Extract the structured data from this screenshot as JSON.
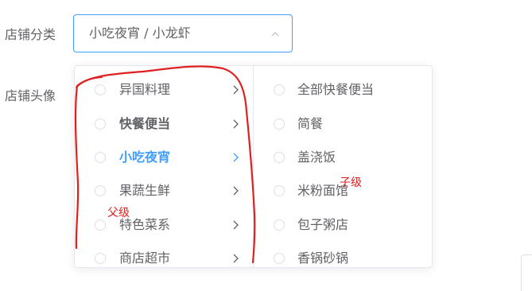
{
  "form": {
    "category_label": "店铺分类",
    "avatar_label": "店铺头像"
  },
  "select": {
    "value": "小吃夜宵 / 小龙虾",
    "arrow_icon": "chevron-up-icon",
    "border_color": "#409eff"
  },
  "cascader": {
    "parent_items": [
      {
        "label": "异国料理",
        "state": "normal"
      },
      {
        "label": "快餐便当",
        "state": "bold"
      },
      {
        "label": "小吃夜宵",
        "state": "active"
      },
      {
        "label": "果蔬生鲜",
        "state": "normal"
      },
      {
        "label": "特色菜系",
        "state": "normal"
      },
      {
        "label": "商店超市",
        "state": "normal"
      }
    ],
    "child_items": [
      {
        "label": "全部快餐便当"
      },
      {
        "label": "简餐"
      },
      {
        "label": "盖浇饭"
      },
      {
        "label": "米粉面馆"
      },
      {
        "label": "包子粥店"
      },
      {
        "label": "香锅砂锅"
      }
    ],
    "active_color": "#409eff"
  },
  "annotations": {
    "parent_note": "父级",
    "child_note": "子级",
    "color": "#e02020"
  }
}
